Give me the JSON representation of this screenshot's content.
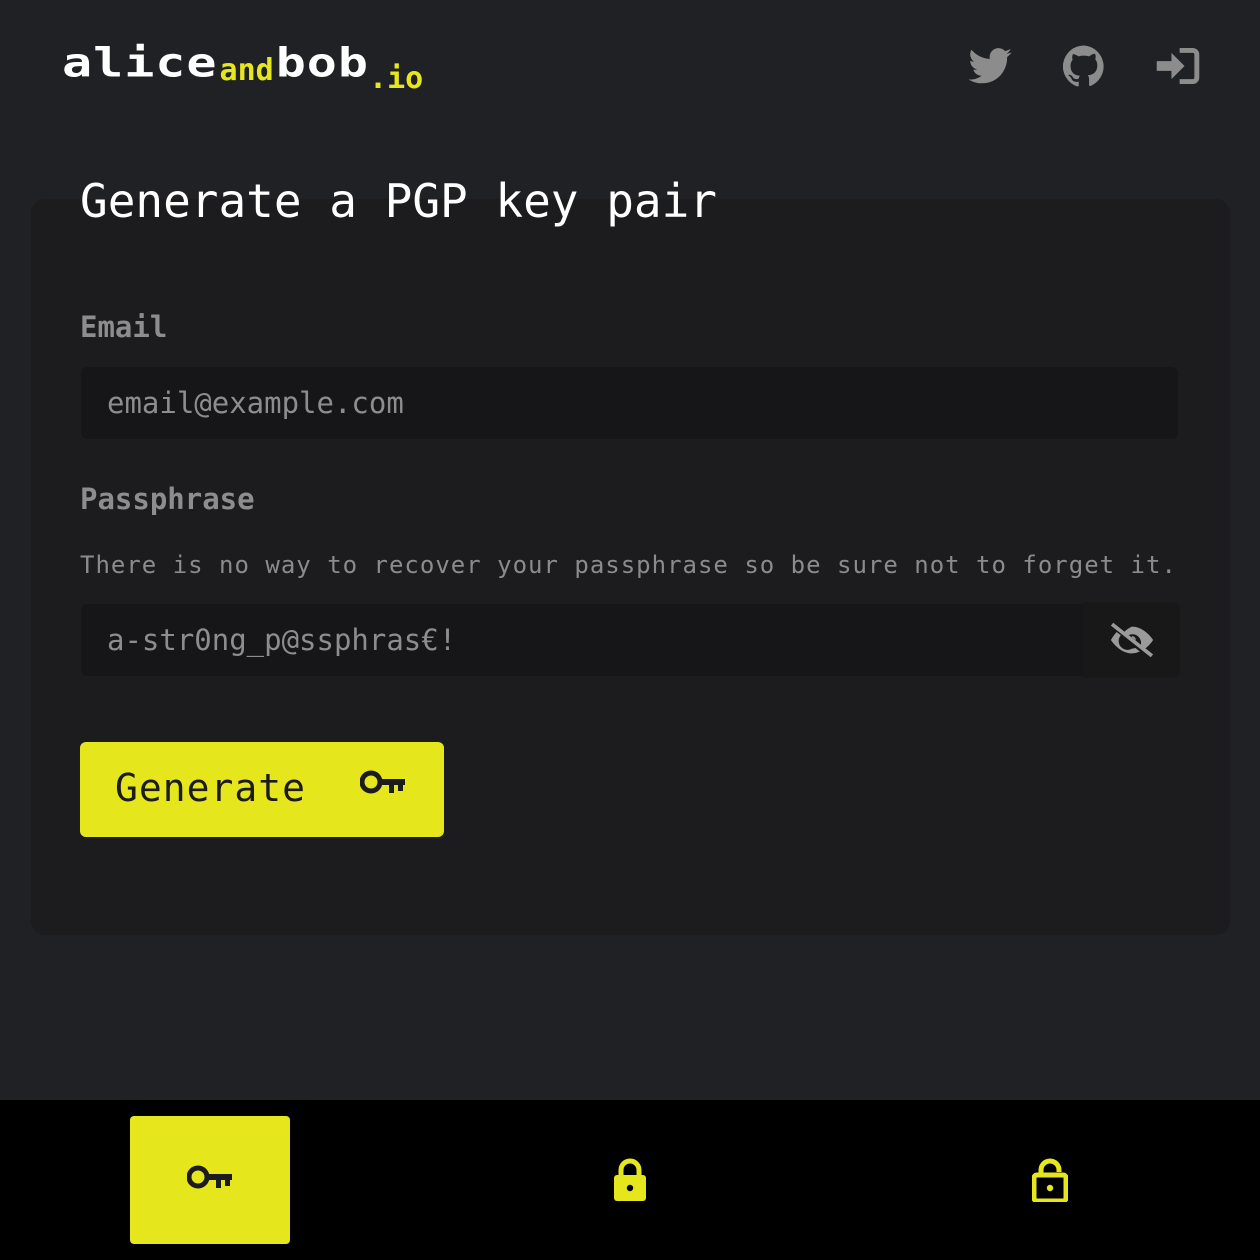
{
  "logo": {
    "part1": "alice",
    "part2": "and",
    "part3": "bob",
    "part4": ".io"
  },
  "header_icons": [
    "twitter-icon",
    "github-icon",
    "sign-in-icon"
  ],
  "page_title": "Generate a PGP key pair",
  "form": {
    "email_label": "Email",
    "email_placeholder": "email@example.com",
    "passphrase_label": "Passphrase",
    "passphrase_help": "There is no way to recover your passphrase so be sure not to forget it.",
    "passphrase_placeholder": "a-str0ng_p@ssphras€!",
    "toggle_icon": "eye-slash-icon",
    "generate_label": "Generate",
    "generate_icon": "key-icon"
  },
  "bottom_nav": {
    "items": [
      {
        "icon": "key-icon",
        "active": true
      },
      {
        "icon": "lock-icon",
        "active": false
      },
      {
        "icon": "lock-open-icon",
        "active": false
      }
    ]
  },
  "colors": {
    "accent": "#e6e61d",
    "background": "#202125",
    "card": "#1c1c1f",
    "input": "#161618",
    "muted_text": "#8d8d8d",
    "nav_bar": "#000000"
  }
}
